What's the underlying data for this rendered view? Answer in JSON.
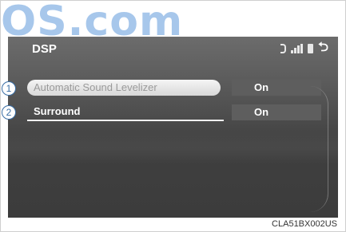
{
  "watermark": "OS.com",
  "screen": {
    "title": "DSP",
    "status_icons": [
      "bluetooth-icon",
      "signal-icon",
      "battery-icon",
      "back-icon"
    ],
    "back_glyph": "⮌",
    "rows": [
      {
        "label": "Automatic Sound Levelizer",
        "value": "On",
        "selected": true
      },
      {
        "label": "Surround",
        "value": "On",
        "selected": false
      }
    ]
  },
  "callouts": [
    "1",
    "2"
  ],
  "caption": "CLA51BX002US",
  "colors": {
    "screen_bg": "#5a5a5a",
    "selected_bg": "#e6e6e6",
    "callout": "#3a6ea5"
  }
}
